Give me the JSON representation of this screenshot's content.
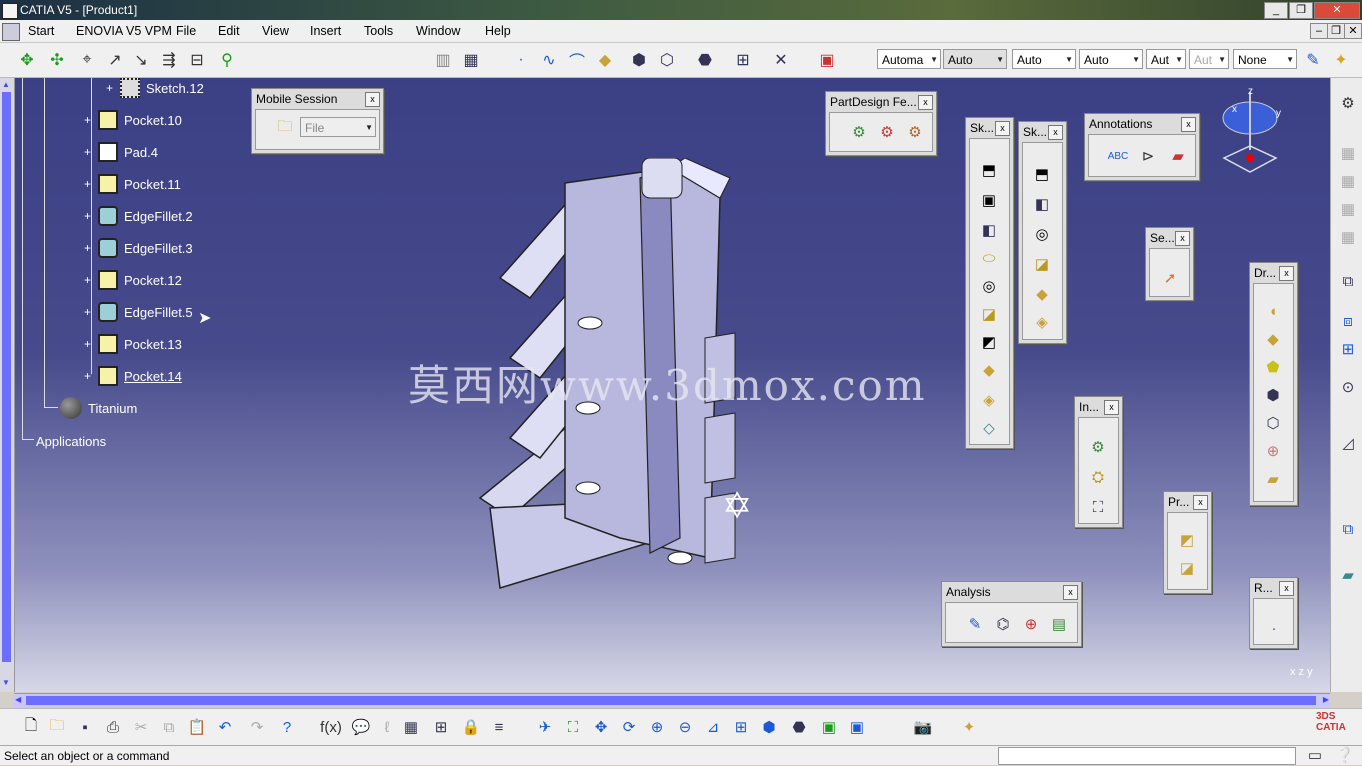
{
  "window": {
    "title": "CATIA V5 - [Product1]",
    "minimize": "_",
    "restore": "❐",
    "close": "✕",
    "doc_min": "–",
    "doc_restore": "❐",
    "doc_close": "✕"
  },
  "menu": [
    "Start",
    "ENOVIA V5 VPM",
    "File",
    "Edit",
    "View",
    "Insert",
    "Tools",
    "Window",
    "Help"
  ],
  "combos": [
    {
      "value": "Automa"
    },
    {
      "value": "Auto"
    },
    {
      "value": "Auto"
    },
    {
      "value": "Auto"
    },
    {
      "value": "Aut"
    },
    {
      "value": "Aut"
    },
    {
      "value": "None"
    }
  ],
  "tree": {
    "items": [
      {
        "label": "Sketch.12",
        "kind": "sketch"
      },
      {
        "label": "Pocket.10",
        "kind": "pocket"
      },
      {
        "label": "Pad.4",
        "kind": "pad"
      },
      {
        "label": "Pocket.11",
        "kind": "pocket"
      },
      {
        "label": "EdgeFillet.2",
        "kind": "fillet"
      },
      {
        "label": "EdgeFillet.3",
        "kind": "fillet"
      },
      {
        "label": "Pocket.12",
        "kind": "pocket"
      },
      {
        "label": "EdgeFillet.5",
        "kind": "fillet"
      },
      {
        "label": "Pocket.13",
        "kind": "pocket"
      },
      {
        "label": "Pocket.14",
        "kind": "pocket"
      }
    ],
    "material": "Titanium",
    "applications": "Applications"
  },
  "panels": {
    "mobile_session": {
      "title": "Mobile Session",
      "combo": "File"
    },
    "partdesign": {
      "title": "PartDesign Fe..."
    },
    "sk1": {
      "title": "Sk..."
    },
    "sk2": {
      "title": "Sk..."
    },
    "annotations": {
      "title": "Annotations"
    },
    "se": {
      "title": "Se..."
    },
    "dr": {
      "title": "Dr..."
    },
    "in": {
      "title": "In..."
    },
    "pr": {
      "title": "Pr..."
    },
    "analysis": {
      "title": "Analysis"
    },
    "r": {
      "title": "R..."
    },
    "close_label": "x"
  },
  "watermark": "莫西网www.3dmox.com",
  "compass_axes": {
    "x": "x",
    "y": "y",
    "z": "z"
  },
  "corner_axes": "x z y",
  "status": "Select an object or a command",
  "icons": {
    "app": "catia-icon",
    "folder": "folder-icon",
    "cursor": "arrow-cursor-icon"
  }
}
